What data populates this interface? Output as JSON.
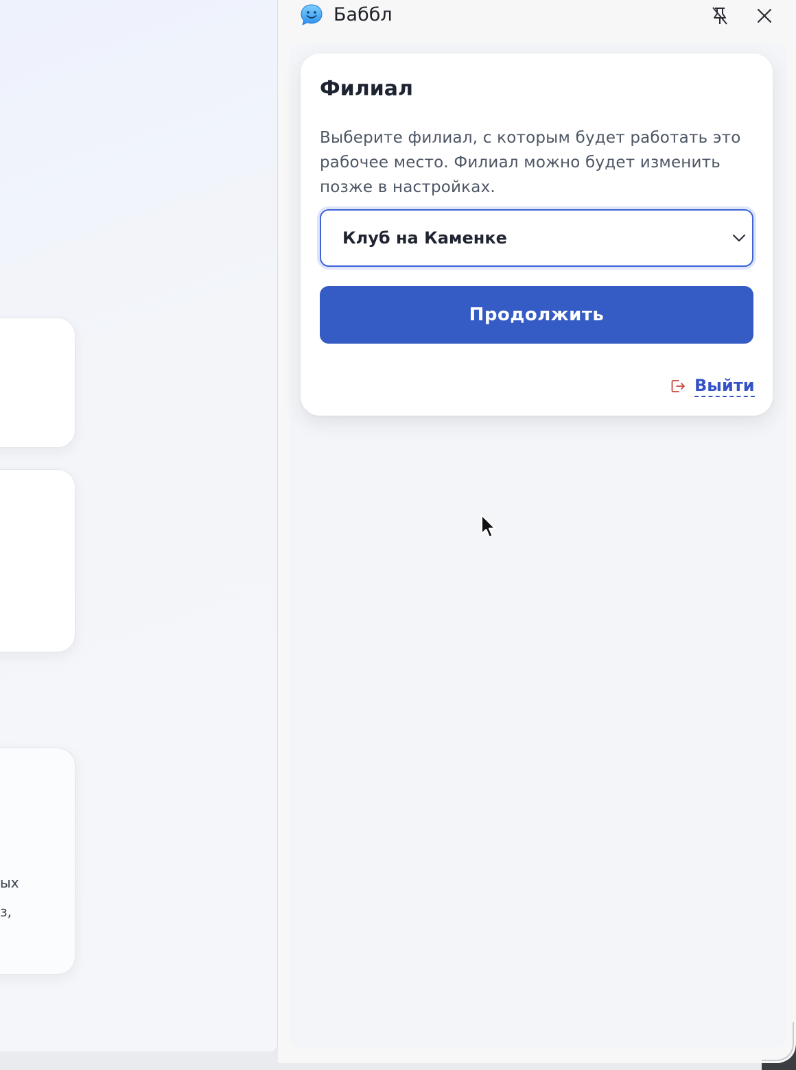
{
  "background_page": {
    "text_fragments": [
      "ых",
      "з,"
    ]
  },
  "panel": {
    "app_name": "Баббл",
    "icons": {
      "app": "speech-bubble-smile-icon",
      "pin": "unpin-icon",
      "close": "close-icon"
    }
  },
  "card": {
    "title": "Филиал",
    "description": "Выберите филиал, с которым будет работать это рабочее место. Филиал можно будет изменить позже в настройках.",
    "branch_select": {
      "selected": "Клуб на Каменке",
      "icon": "chevron-down-icon"
    },
    "continue_label": "Продолжить",
    "logout": {
      "label": "Выйти",
      "icon": "logout-icon",
      "color": "#3553c4",
      "icon_color": "#c9473c"
    },
    "accent_color": "#355bc4"
  }
}
